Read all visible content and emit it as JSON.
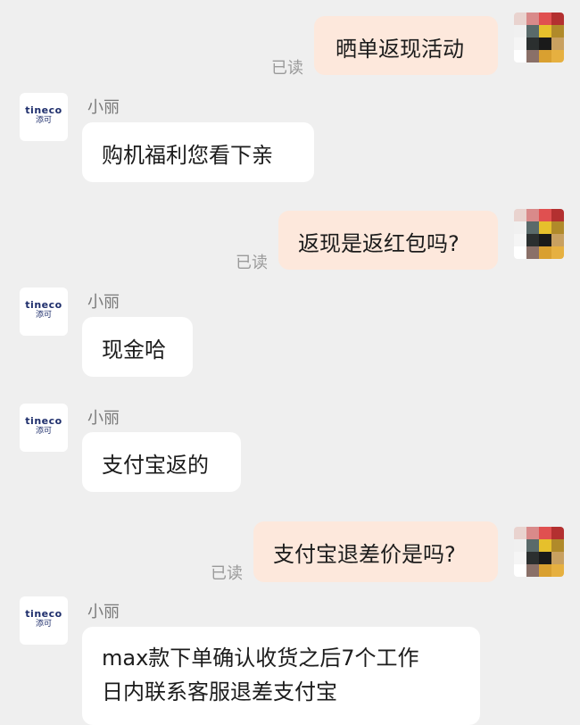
{
  "user_avatar_colors": [
    [
      "#e9d3cf",
      "#d98a8a",
      "#e05050",
      "#b33030"
    ],
    [
      "#f0f0f0",
      "#5a6a6a",
      "#e6c02c",
      "#b08a2a"
    ],
    [
      "#f5f5f5",
      "#2b2f2f",
      "#1a1a1a",
      "#c8a060"
    ],
    [
      "#ffffff",
      "#8a7068",
      "#d9a030",
      "#e6b040"
    ]
  ],
  "brand": {
    "logo_en": "tineco",
    "logo_cn": "添可"
  },
  "messages": [
    {
      "id": "m1",
      "dir": "out",
      "text": "晒单返现活动",
      "status": "已读"
    },
    {
      "id": "m2",
      "dir": "in",
      "sender": "小丽",
      "text": "购机福利您看下亲"
    },
    {
      "id": "m3",
      "dir": "out",
      "text": "返现是返红包吗?",
      "status": "已读"
    },
    {
      "id": "m4",
      "dir": "in",
      "sender": "小丽",
      "text": "现金哈"
    },
    {
      "id": "m5",
      "dir": "in",
      "sender": "小丽",
      "text": "支付宝返的"
    },
    {
      "id": "m6",
      "dir": "out",
      "text": "支付宝退差价是吗?",
      "status": "已读"
    },
    {
      "id": "m7",
      "dir": "in",
      "sender": "小丽",
      "lines": [
        "max款下单确认收货之后7个工作",
        "日内联系客服退差支付宝"
      ]
    }
  ]
}
